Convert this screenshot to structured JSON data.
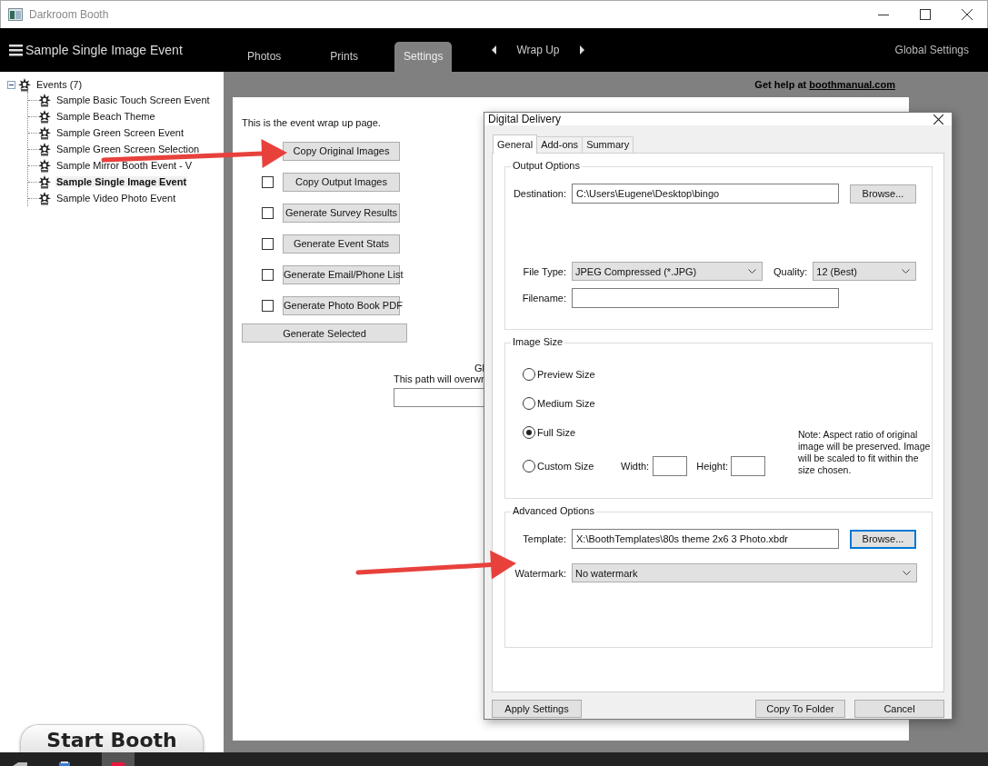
{
  "window": {
    "title": "Darkroom Booth"
  },
  "nav": {
    "event_title": "Sample Single Image Event",
    "tabs": [
      {
        "label": "Photos",
        "selected": false
      },
      {
        "label": "Prints",
        "selected": false
      },
      {
        "label": "Settings",
        "selected": true
      }
    ],
    "step": "Wrap Up",
    "global_settings": "Global Settings"
  },
  "tree": {
    "label": "Events (7)",
    "expanded": true,
    "children": [
      {
        "label": "Sample Basic Touch Screen Event",
        "selected": false
      },
      {
        "label": "Sample Beach Theme",
        "selected": false
      },
      {
        "label": "Sample Green Screen Event",
        "selected": false
      },
      {
        "label": "Sample Green Screen Selection",
        "selected": false
      },
      {
        "label": "Sample Mirror Booth Event - V",
        "selected": false
      },
      {
        "label": "Sample Single Image Event",
        "selected": true
      },
      {
        "label": "Sample Video Photo Event",
        "selected": false
      }
    ]
  },
  "start_button": "Start Booth",
  "page": {
    "help_prefix": "Get help at",
    "help_link": "boothmanual.com",
    "intro": "This is the event wrap up page.",
    "actions": [
      {
        "label": "Copy Original Images"
      },
      {
        "label": "Copy Output Images",
        "checked": false
      },
      {
        "label": "Generate Survey Results",
        "checked": false
      },
      {
        "label": "Generate Event Stats",
        "checked": false
      },
      {
        "label": "Generate Email/Phone List",
        "checked": false
      },
      {
        "label": "Generate Photo Book PDF",
        "checked": false
      }
    ],
    "generate_button": "Generate Selected",
    "path_heading": "Gl",
    "path_note": "This path will overwr"
  },
  "dialog": {
    "title": "Digital Delivery",
    "tabs": [
      {
        "label": "General",
        "selected": true
      },
      {
        "label": "Add-ons",
        "selected": false
      },
      {
        "label": "Summary",
        "selected": false
      }
    ],
    "output_options": {
      "title": "Output Options",
      "destination_label": "Destination:",
      "destination": "C:\\Users\\Eugene\\Desktop\\bingo",
      "browse": "Browse...",
      "file_type_label": "File Type:",
      "file_type": "JPEG Compressed (*.JPG)",
      "quality_label": "Quality:",
      "quality": "12 (Best)",
      "filename_label": "Filename:"
    },
    "image_size": {
      "title": "Image Size",
      "options": [
        {
          "label": "Preview Size",
          "selected": false
        },
        {
          "label": "Medium Size",
          "selected": false
        },
        {
          "label": "Full Size",
          "selected": true
        },
        {
          "label": "Custom Size",
          "selected": false
        }
      ],
      "width_label": "Width:",
      "height_label": "Height:",
      "note": "Note: Aspect ratio of original image will be preserved. Image will be scaled to fit within the size chosen."
    },
    "advanced": {
      "title": "Advanced Options",
      "template_label": "Template:",
      "template": "X:\\BoothTemplates\\80s theme 2x6 3 Photo.xbdr",
      "browse": "Browse...",
      "browse_focused": true,
      "watermark_label": "Watermark:",
      "watermark": "No watermark"
    },
    "buttons": [
      "Apply Settings",
      "Copy To Folder",
      "Cancel"
    ]
  }
}
